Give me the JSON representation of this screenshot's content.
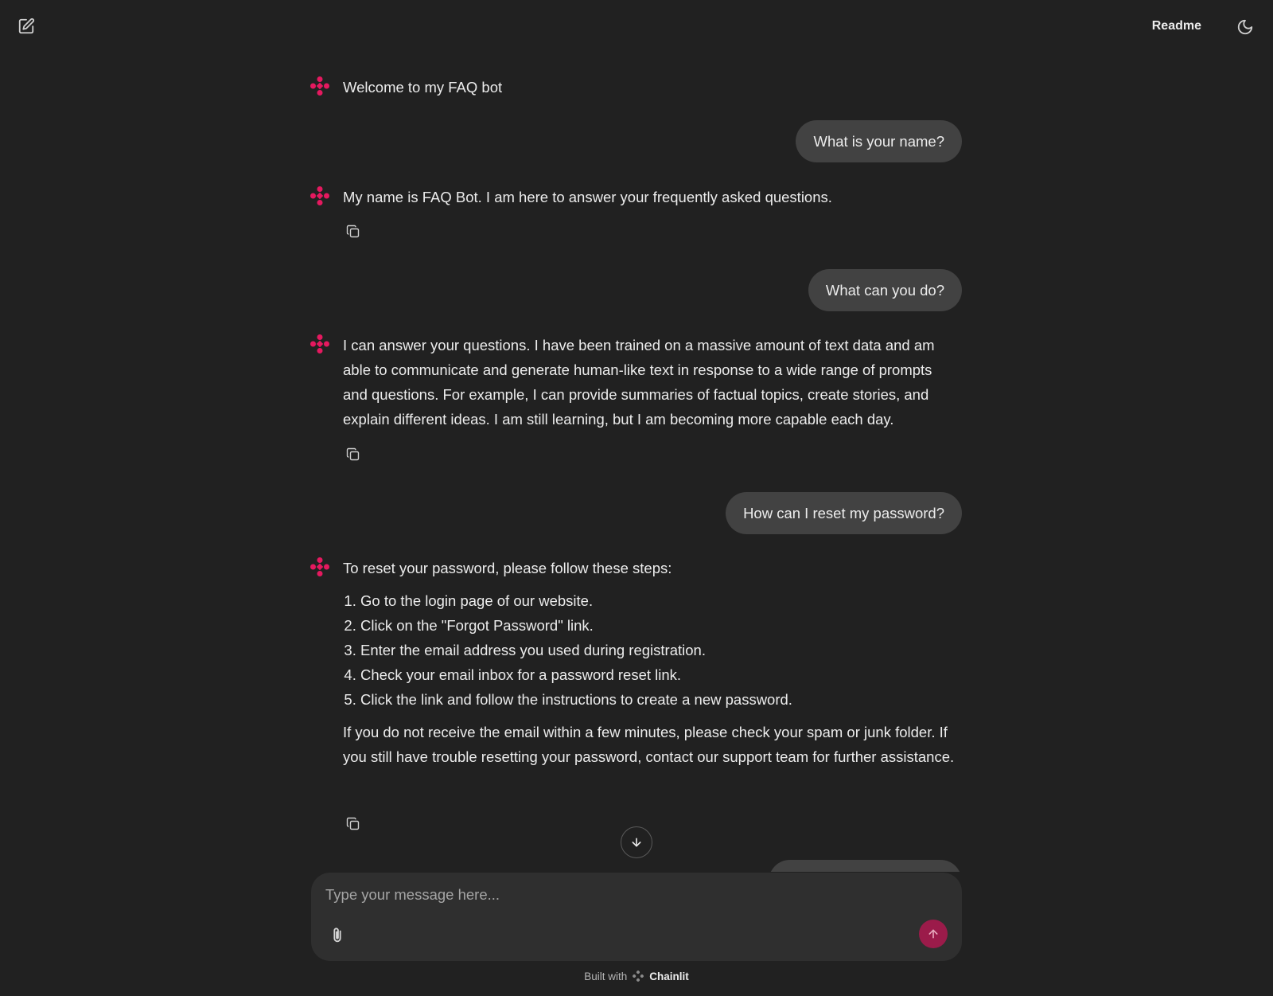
{
  "header": {
    "new_chat_icon": "edit-square-icon",
    "readme_label": "Readme",
    "theme_icon": "moon-icon"
  },
  "colors": {
    "background": "#212121",
    "user_bubble": "#424242",
    "composer": "#2f2f2f",
    "accent": "#e5195f",
    "send_button": "#9b1b4a"
  },
  "messages": [
    {
      "role": "assistant",
      "text": "Welcome to my FAQ bot"
    },
    {
      "role": "user",
      "text": "What is your name?"
    },
    {
      "role": "assistant",
      "text": "My name is FAQ Bot. I am here to answer your frequently asked questions."
    },
    {
      "role": "user",
      "text": "What can you do?"
    },
    {
      "role": "assistant",
      "text": "I can answer your questions. I have been trained on a massive amount of text data and am able to communicate and generate human-like text in response to a wide range of prompts and questions. For example, I can provide summaries of factual topics, create stories, and explain different ideas. I am still learning, but I am becoming more capable each day."
    },
    {
      "role": "user",
      "text": "How can I reset my password?"
    },
    {
      "role": "assistant",
      "intro": "To reset your password, please follow these steps:",
      "steps": [
        "Go to the login page of our website.",
        "Click on the \"Forgot Password\" link.",
        "Enter the email address you used during registration.",
        "Check your email inbox for a password reset link.",
        "Click the link and follow the instructions to create a new password."
      ],
      "outro": "If you do not receive the email within a few minutes, please check your spam or junk folder. If you still have trouble resetting your password, contact our support team for further assistance."
    }
  ],
  "composer": {
    "placeholder": "Type your message here...",
    "attach_icon": "paperclip-icon",
    "send_icon": "arrow-up-icon"
  },
  "scroll_down_icon": "arrow-down-icon",
  "footer": {
    "prefix": "Built with",
    "brand": "Chainlit"
  }
}
